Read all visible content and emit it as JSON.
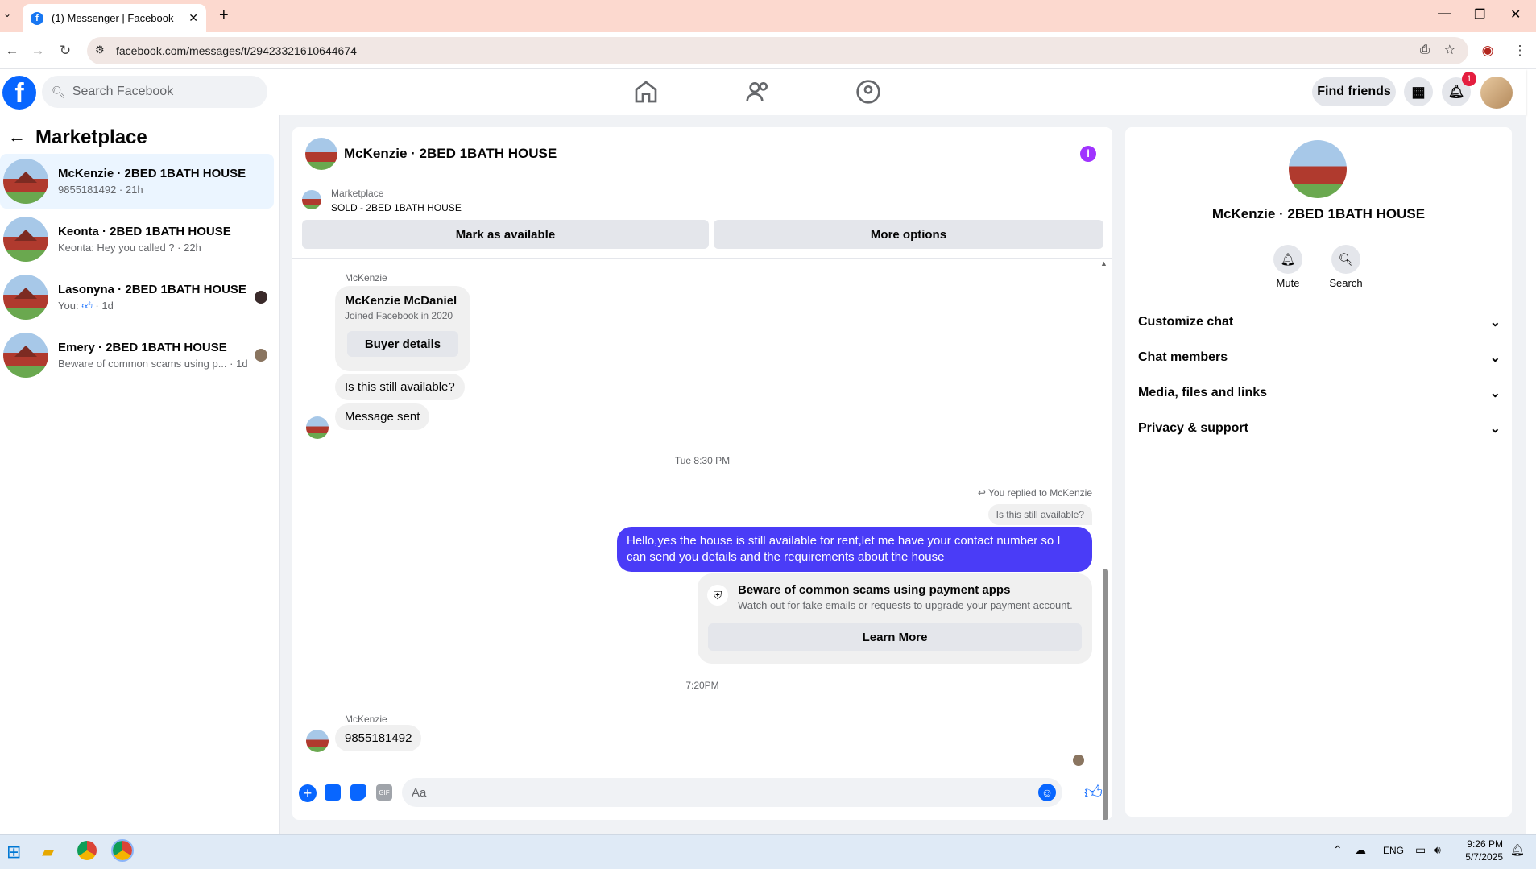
{
  "browser": {
    "tab_title": "(1) Messenger | Facebook",
    "url": "facebook.com/messages/t/29423321610644674"
  },
  "header": {
    "search_placeholder": "Search Facebook",
    "find_friends": "Find friends",
    "notification_count": "1"
  },
  "sidebar": {
    "title": "Marketplace",
    "conversations": [
      {
        "name": "McKenzie · 2BED 1BATH HOUSE",
        "preview": "9855181492 · 21h"
      },
      {
        "name": "Keonta · 2BED 1BATH HOUSE",
        "preview": "Keonta: Hey you called ? · 22h"
      },
      {
        "name": "Lasonyna · 2BED 1BATH HOUSE",
        "preview_prefix": "You:",
        "preview_suffix": "· 1d"
      },
      {
        "name": "Emery · 2BED 1BATH HOUSE",
        "preview": "Beware of common scams using p... · 1d"
      }
    ]
  },
  "chat": {
    "title": "McKenzie · 2BED 1BATH HOUSE",
    "listing_source": "Marketplace",
    "listing_status": "SOLD - 2BED 1BATH HOUSE",
    "mark_available": "Mark as available",
    "more_options": "More options",
    "sender_name_1": "McKenzie",
    "profile_name": "McKenzie McDaniel",
    "profile_joined": "Joined Facebook in 2020",
    "buyer_details": "Buyer details",
    "msg_available": "Is this still available?",
    "msg_sent": "Message sent",
    "time_1": "Tue 8:30 PM",
    "replied_to": "You replied to McKenzie",
    "quoted": "Is this still available?",
    "my_message": "Hello,yes the house is still available for rent,let me have your contact number  so I can send you details and the requirements about the house",
    "scam_title": "Beware of common scams using payment apps",
    "scam_body": "Watch out for fake emails or requests to upgrade your payment account.",
    "learn_more": "Learn More",
    "time_2": "7:20PM",
    "sender_name_2": "McKenzie",
    "phone_msg": "9855181492",
    "composer_placeholder": "Aa"
  },
  "info": {
    "title": "McKenzie · 2BED 1BATH HOUSE",
    "mute": "Mute",
    "search": "Search",
    "sections": [
      "Customize chat",
      "Chat members",
      "Media, files and links",
      "Privacy & support"
    ]
  },
  "taskbar": {
    "lang": "ENG",
    "time": "9:26 PM",
    "date": "5/7/2025"
  },
  "colors": {
    "accent": "#0866ff",
    "my_bubble": "#4a3cf7",
    "info_icon": "#a033ff"
  }
}
